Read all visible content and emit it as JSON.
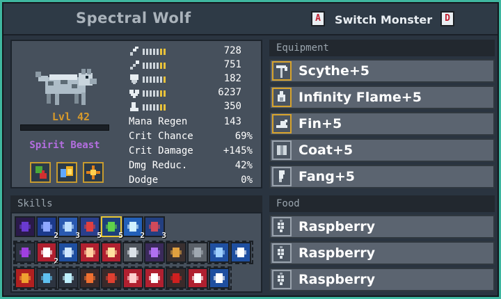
{
  "header": {
    "monster_name": "Spectral Wolf",
    "key_prev": "A",
    "key_next": "D",
    "switch_label": "Switch Monster"
  },
  "monster": {
    "level": "Lvl 42",
    "level_progress": 1.0,
    "class": "Spirit Beast",
    "badge_icons": [
      "leaf-up-icon",
      "flame-drop-icon",
      "sparkle-icon"
    ]
  },
  "stats": [
    {
      "icon": "sword-icon",
      "value": "728",
      "pips": 7,
      "gold_pips": 2
    },
    {
      "icon": "wand-icon",
      "value": "751",
      "pips": 7,
      "gold_pips": 2
    },
    {
      "icon": "shield-icon",
      "value": "182",
      "pips": 7,
      "gold_pips": 1
    },
    {
      "icon": "heart-icon",
      "value": "6237",
      "pips": 7,
      "gold_pips": 2
    },
    {
      "icon": "boot-icon",
      "value": "350",
      "pips": 7,
      "gold_pips": 2
    }
  ],
  "secondary_stats": [
    {
      "label": "Mana Regen",
      "value": "143"
    },
    {
      "label": "Crit Chance",
      "value": "69%"
    },
    {
      "label": "Crit Damage",
      "value": "+145%"
    },
    {
      "label": "Dmg Reduc.",
      "value": "42%"
    },
    {
      "label": "Dodge",
      "value": "0%"
    }
  ],
  "equipment": {
    "title": "Equipment",
    "items": [
      {
        "label": "Scythe+5",
        "icon": "scythe-icon",
        "highlight": true
      },
      {
        "label": "Infinity Flame+5",
        "icon": "flame-icon",
        "highlight": true
      },
      {
        "label": "Fin+5",
        "icon": "fin-icon",
        "highlight": true
      },
      {
        "label": "Coat+5",
        "icon": "coat-icon",
        "highlight": false
      },
      {
        "label": "Fang+5",
        "icon": "fang-icon",
        "highlight": false
      }
    ]
  },
  "food": {
    "title": "Food",
    "items": [
      {
        "label": "Raspberry",
        "icon": "raspberry-icon"
      },
      {
        "label": "Raspberry",
        "icon": "raspberry-icon"
      },
      {
        "label": "Raspberry",
        "icon": "raspberry-icon"
      }
    ]
  },
  "skills": {
    "title": "Skills",
    "row1": [
      {
        "name": "void-orb-skill",
        "color": "#2a1a4a",
        "accent": "#6a3ad0",
        "num": ""
      },
      {
        "name": "shadow-flame-skill",
        "color": "#1c3a8c",
        "accent": "#8fa8ff",
        "num": "2"
      },
      {
        "name": "ice-blade-skill",
        "color": "#2a5ab0",
        "accent": "#bfe0ff",
        "num": "3"
      },
      {
        "name": "blood-claw-skill",
        "color": "#2a3f8c",
        "accent": "#e04040",
        "num": "5"
      },
      {
        "name": "poison-ring-skill",
        "color": "#1d3f7a",
        "accent": "#5fd04a",
        "num": "5",
        "selected": true
      },
      {
        "name": "frost-burst-skill",
        "color": "#2360b8",
        "accent": "#d0f0ff",
        "num": "2"
      },
      {
        "name": "red-rain-skill",
        "color": "#233f80",
        "accent": "#d04a5a",
        "num": "3"
      }
    ],
    "row2": [
      {
        "name": "swirl-skill",
        "color": "#2d3440",
        "accent": "#a040e0",
        "num": ""
      },
      {
        "name": "rune-skill",
        "color": "#b02030",
        "accent": "#ffffff",
        "num": "2"
      },
      {
        "name": "hourglass-blue-skill",
        "color": "#1f4fa0",
        "accent": "#d0e8ff",
        "num": ""
      },
      {
        "name": "hourglass-red-skill",
        "color": "#b02030",
        "accent": "#ffd0a0",
        "num": ""
      },
      {
        "name": "slash-skill",
        "color": "#b02030",
        "accent": "#ffe0a0",
        "num": ""
      },
      {
        "name": "cross-skill",
        "color": "#50565e",
        "accent": "#dde3e8",
        "num": ""
      },
      {
        "name": "wing-skill",
        "color": "#3a2a5a",
        "accent": "#b070f0",
        "num": ""
      },
      {
        "name": "gear-skill",
        "color": "#3a3030",
        "accent": "#e0a040",
        "num": ""
      },
      {
        "name": "stone-skill",
        "color": "#5a6068",
        "accent": "#a0a8b0",
        "num": ""
      },
      {
        "name": "grid-skill",
        "color": "#1f4fa0",
        "accent": "#9fd0ff",
        "num": ""
      },
      {
        "name": "shield-plus-skill",
        "color": "#1f4fa0",
        "accent": "#ffffff",
        "num": ""
      }
    ],
    "row3": [
      {
        "name": "fire-cross-skill",
        "color": "#b02020",
        "accent": "#f0a030",
        "num": ""
      },
      {
        "name": "spear-skill",
        "color": "#2d3440",
        "accent": "#5fc0f0",
        "num": ""
      },
      {
        "name": "ice-gem-skill",
        "color": "#2d3440",
        "accent": "#bff0ff",
        "num": ""
      },
      {
        "name": "flame-arrow-skill",
        "color": "#3a2a2a",
        "accent": "#f07030",
        "num": ""
      },
      {
        "name": "fire-sword-skill",
        "color": "#3a2a2a",
        "accent": "#e04030",
        "num": ""
      },
      {
        "name": "heart-rune-skill",
        "color": "#b02030",
        "accent": "#ffd0d0",
        "num": ""
      },
      {
        "name": "claw-rune-skill",
        "color": "#b02030",
        "accent": "#ffffff",
        "num": ""
      },
      {
        "name": "blood-drop-skill",
        "color": "#3a2a2a",
        "accent": "#d02020",
        "num": ""
      },
      {
        "name": "crest-skill",
        "color": "#b02030",
        "accent": "#ffffff",
        "num": ""
      },
      {
        "name": "book-plus-skill",
        "color": "#1f4fa0",
        "accent": "#ffffff",
        "num": ""
      }
    ]
  }
}
